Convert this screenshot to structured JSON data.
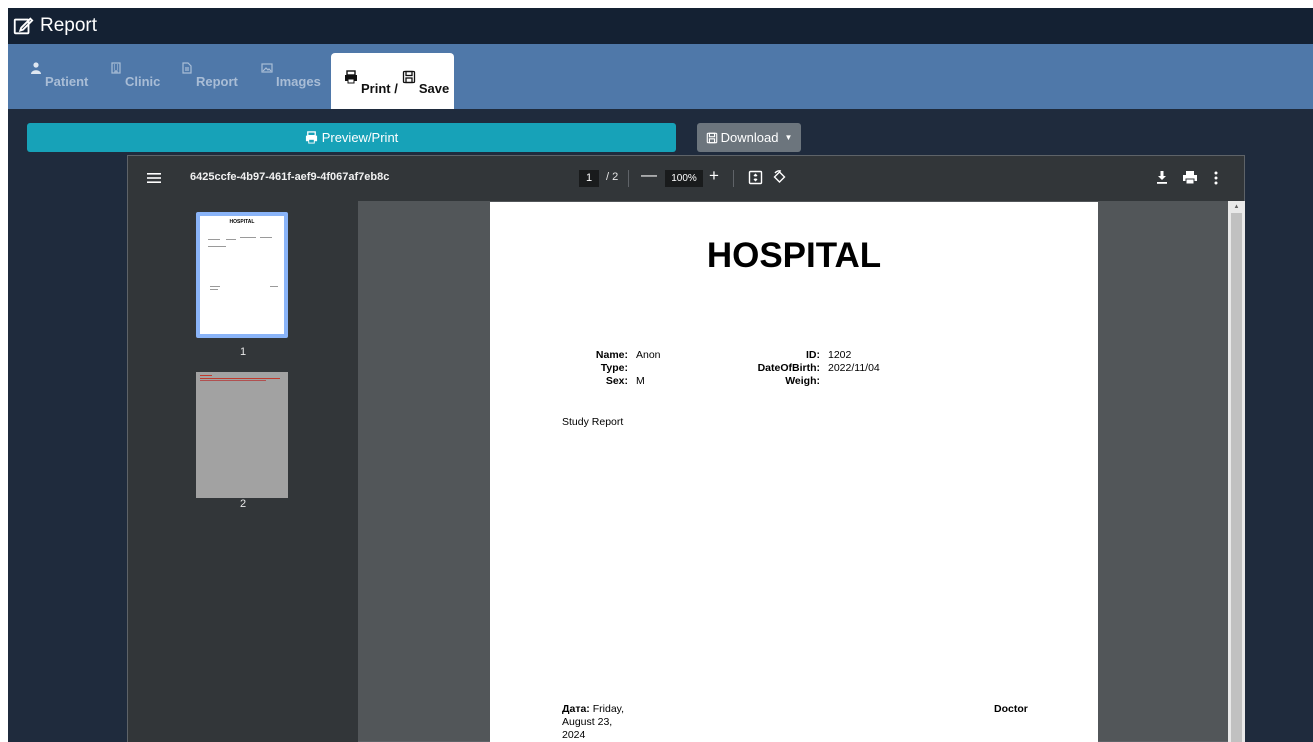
{
  "window": {
    "title": "Report"
  },
  "tabs": [
    {
      "label": "Patient",
      "icon": "user-icon"
    },
    {
      "label": "Clinic",
      "icon": "building-icon"
    },
    {
      "label": "Report",
      "icon": "file-icon"
    },
    {
      "label": "Images",
      "icon": "image-icon"
    },
    {
      "label_print": "Print /",
      "label_save": "Save",
      "icon": "print-icon",
      "active": true
    }
  ],
  "actions": {
    "preview_label": "Preview/Print",
    "download_label": "Download"
  },
  "pdf_viewer": {
    "file_name": "6425ccfe-4b97-461f-aef9-4f067af7eb8c",
    "current_page": "1",
    "total_pages": "/ 2",
    "zoom": "100%",
    "thumbnails": [
      {
        "label": "1"
      },
      {
        "label": "2"
      }
    ]
  },
  "document": {
    "title": "HOSPITAL",
    "left_fields": [
      {
        "label": "Name:",
        "value": "Anon"
      },
      {
        "label": "Type:",
        "value": ""
      },
      {
        "label": "Sex:",
        "value": "M"
      }
    ],
    "right_fields": [
      {
        "label": "ID:",
        "value": "1202"
      },
      {
        "label": "DateOfBirth:",
        "value": "2022/11/04"
      },
      {
        "label": "Weigh:",
        "value": ""
      }
    ],
    "study_report": "Study Report",
    "date_label": "Дата:",
    "date_value": "Friday, August 23, 2024",
    "doctor_label": "Doctor"
  },
  "colors": {
    "titlebar": "#142133",
    "tabbar": "#4f78a9",
    "app_bg": "#1f2b3d",
    "preview_button": "#17a2b8",
    "download_button": "#6c757d",
    "viewer_toolbar": "#323639",
    "viewer_bg": "#525659",
    "thumb_selected": "#8ab4f8"
  }
}
